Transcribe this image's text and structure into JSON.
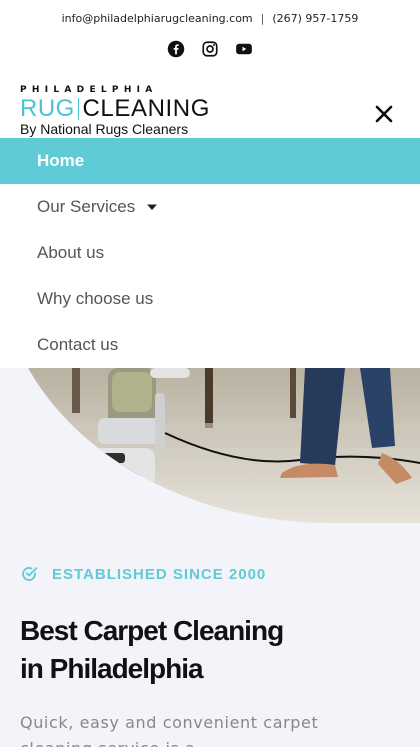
{
  "topbar": {
    "email": "info@philadelphiarugcleaning.com",
    "separator": "|",
    "phone": "(267) 957-1759",
    "social_icons": [
      "facebook-icon",
      "instagram-icon",
      "youtube-icon"
    ]
  },
  "logo": {
    "top": "PHILADELPHIA",
    "rug": "RUG",
    "cleaning": "CLEANING",
    "sub": "By National Rugs Cleaners"
  },
  "header": {
    "close_icon": "close-icon"
  },
  "nav": {
    "items": [
      {
        "label": "Home",
        "active": true
      },
      {
        "label": "Our Services",
        "has_dropdown": true
      },
      {
        "label": "About us"
      },
      {
        "label": "Why choose us"
      },
      {
        "label": "Contact us"
      }
    ]
  },
  "content": {
    "established": "ESTABLISHED SINCE 2000",
    "headline_line1": "Best Carpet Cleaning",
    "headline_line2": "in Philadelphia",
    "lead_line1": "Quick, easy and convenient carpet",
    "lead_line2": "cleaning service is a"
  },
  "colors": {
    "accent": "#5ecbd6",
    "logo_accent": "#4cc2d0",
    "text_dark": "#111111",
    "text_muted": "#888888",
    "page_bg": "#f3f3fa"
  }
}
